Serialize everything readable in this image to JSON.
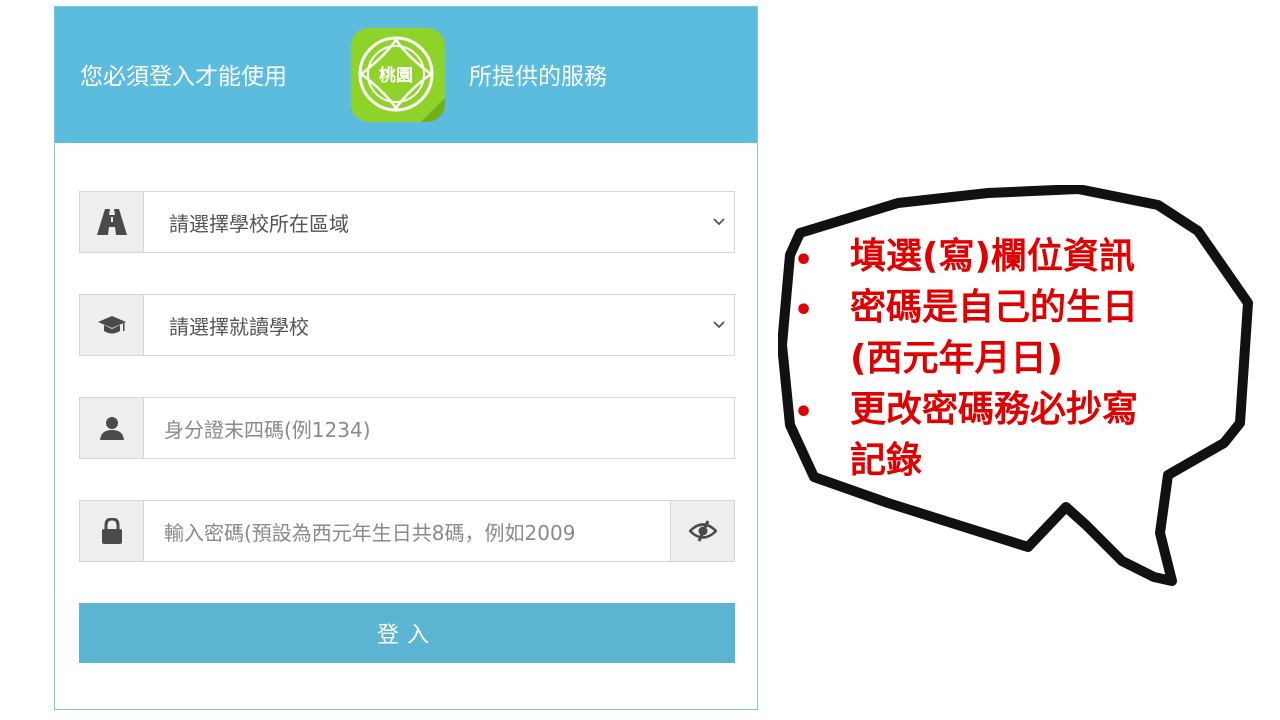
{
  "header": {
    "title_before_logo": "您必須登入才能使用",
    "title_after_logo": "所提供的服務",
    "logo_text": "桃園"
  },
  "form": {
    "area_select": {
      "value": "請選擇學校所在區域",
      "icon": "road-icon"
    },
    "school_select": {
      "value": "請選擇就讀學校",
      "icon": "graduation-cap-icon"
    },
    "id_input": {
      "placeholder": "身分證末四碼(例1234)",
      "icon": "user-icon"
    },
    "password_input": {
      "placeholder": "輸入密碼(預設為西元年生日共8碼，例如2009",
      "icon": "lock-icon",
      "toggle_icon": "eye-toggle-icon"
    },
    "login_label": "登入"
  },
  "callout": {
    "notes": [
      {
        "line1": "填選(寫)欄位資訊"
      },
      {
        "line1": "密碼是自己的生日",
        "line2": "(西元年月日)"
      },
      {
        "line1": "更改密碼務必抄寫",
        "line2": "記錄"
      }
    ],
    "text_color": "#e00000"
  },
  "colors": {
    "header_bg": "#5bbcdd",
    "button_bg": "#5bb4d2",
    "logo_bg": "#8fd32a"
  }
}
